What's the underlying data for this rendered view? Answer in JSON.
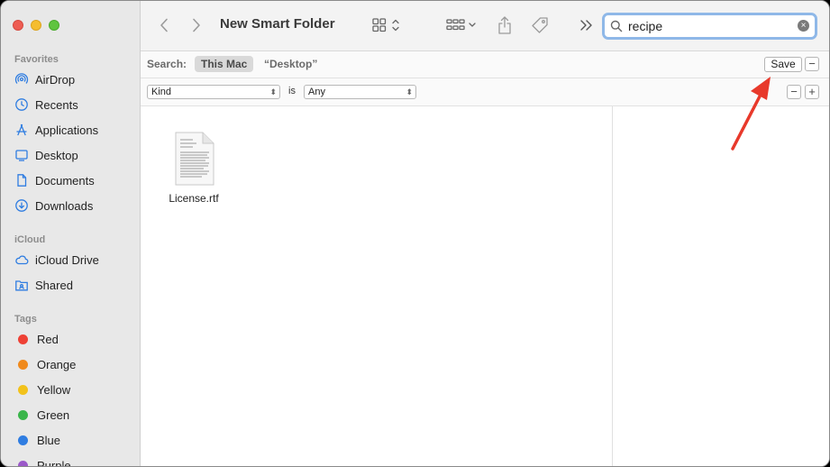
{
  "window": {
    "title": "New Smart Folder"
  },
  "sidebar": {
    "favorites_title": "Favorites",
    "favorites": [
      {
        "label": "AirDrop",
        "icon": "airdrop-icon"
      },
      {
        "label": "Recents",
        "icon": "clock-icon"
      },
      {
        "label": "Applications",
        "icon": "applications-icon"
      },
      {
        "label": "Desktop",
        "icon": "desktop-icon"
      },
      {
        "label": "Documents",
        "icon": "document-icon"
      },
      {
        "label": "Downloads",
        "icon": "downloads-icon"
      }
    ],
    "icloud_title": "iCloud",
    "icloud": [
      {
        "label": "iCloud Drive",
        "icon": "cloud-icon"
      },
      {
        "label": "Shared",
        "icon": "shared-folder-icon"
      }
    ],
    "tags_title": "Tags",
    "tags": [
      {
        "label": "Red",
        "color": "#ee4135"
      },
      {
        "label": "Orange",
        "color": "#f08a1d"
      },
      {
        "label": "Yellow",
        "color": "#f2c21b"
      },
      {
        "label": "Green",
        "color": "#3ab54a"
      },
      {
        "label": "Blue",
        "color": "#2f7de1"
      },
      {
        "label": "Purple",
        "color": "#9b59c9"
      }
    ]
  },
  "search": {
    "value": "recipe"
  },
  "scope": {
    "label": "Search:",
    "this_mac": "This Mac",
    "desktop": "“Desktop”",
    "save_label": "Save",
    "minus_label": "−",
    "plus_label": "+"
  },
  "criteria": {
    "attribute": "Kind",
    "operator": "is",
    "value": "Any"
  },
  "files": [
    {
      "name": "License.rtf"
    }
  ],
  "colors": {
    "accent": "#2f7de1",
    "annotation_arrow": "#e8392b"
  }
}
